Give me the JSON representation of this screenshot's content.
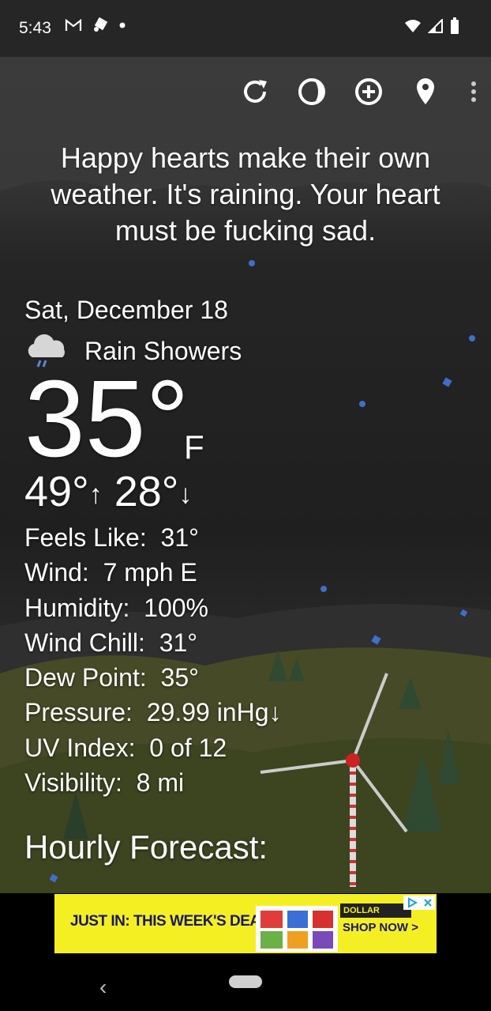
{
  "status_bar": {
    "time": "5:43",
    "icons_left": [
      "gmail-icon",
      "cast-icon",
      "dot-icon"
    ],
    "icons_right": [
      "wifi-icon",
      "cell-signal-icon",
      "battery-icon"
    ]
  },
  "toolbar": {
    "buttons": [
      "refresh-icon",
      "theme-icon",
      "add-location-icon",
      "location-pin-icon",
      "more-options-icon"
    ]
  },
  "quote": "Happy hearts make their own weather. It's raining. Your heart must be fucking sad.",
  "weather": {
    "date": "Sat, December 18",
    "condition": "Rain Showers",
    "condition_icon": "rain-cloud-icon",
    "temperature": "35°",
    "unit": "F",
    "high": "49°",
    "low": "28°",
    "high_arrow": "↑",
    "low_arrow": "↓",
    "details": [
      {
        "label": "Feels Like:",
        "value": "31°"
      },
      {
        "label": "Wind:",
        "value": "7 mph E"
      },
      {
        "label": "Humidity:",
        "value": "100%"
      },
      {
        "label": "Wind Chill:",
        "value": "31°"
      },
      {
        "label": "Dew Point:",
        "value": "35°"
      },
      {
        "label": "Pressure:",
        "value": "29.99 inHg↓"
      },
      {
        "label": "UV Index:",
        "value": "0 of 12"
      },
      {
        "label": "Visibility:",
        "value": "8 mi"
      }
    ],
    "hourly_heading": "Hourly Forecast:"
  },
  "ad": {
    "headline": "JUST IN: THIS WEEK'S DEALS.",
    "brand": "DOLLAR GENERAL",
    "cta": "SHOP NOW >"
  },
  "colors": {
    "rain_particle": "#3f6fc8",
    "ad_background": "#f4ef22"
  }
}
